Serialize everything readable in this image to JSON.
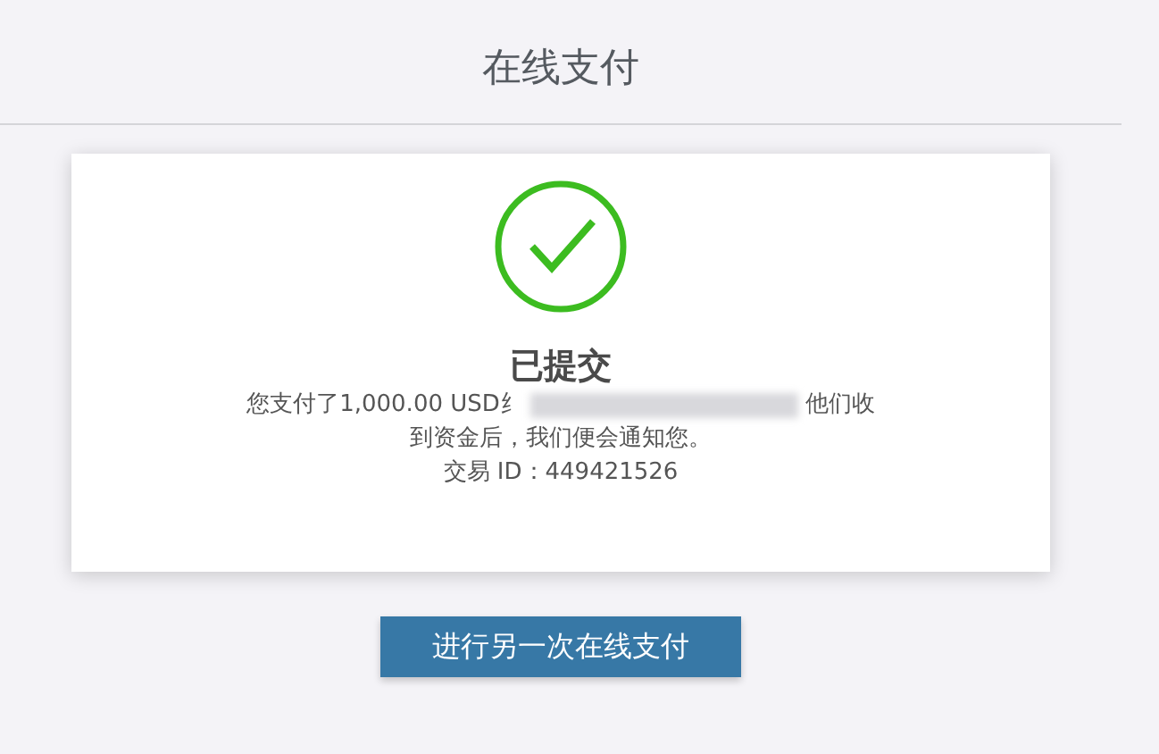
{
  "title": "在线支付",
  "result": {
    "status": "已提交",
    "message_start": "您支付了1,000.00 USD纟",
    "message_end": "他们收",
    "message_line2": "到资金后，我们便会通知您。",
    "transaction": "交易 ID：449421526"
  },
  "button": "进行另一次在线支付"
}
